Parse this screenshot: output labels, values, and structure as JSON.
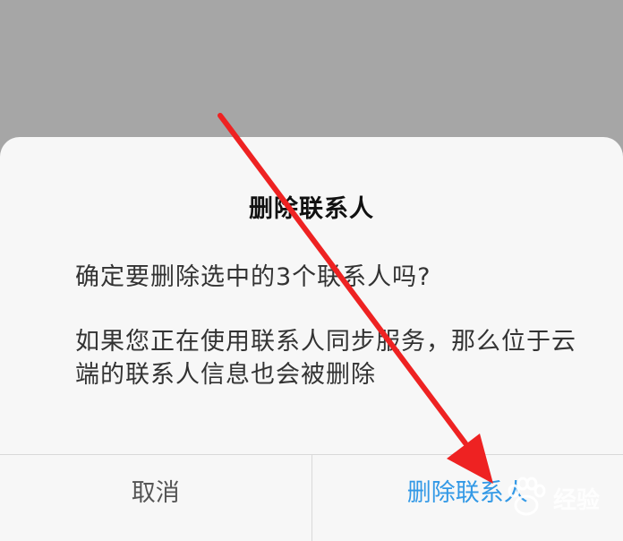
{
  "dialog": {
    "title": "删除联系人",
    "message": "确定要删除选中的3个联系人吗?",
    "detail": "如果您正在使用联系人同步服务，那么位于云端的联系人信息也会被删除",
    "cancel_label": "取消",
    "confirm_label": "删除联系人"
  },
  "watermark": {
    "icon": "paw-icon",
    "text": "经验"
  },
  "annotation": {
    "icon": "red-arrow-icon",
    "color": "#ee2222"
  },
  "colors": {
    "backdrop": "#a6a6a6",
    "dialog_bg": "#f7f7f7",
    "confirm_text": "#3399e6",
    "cancel_text": "#555555"
  }
}
